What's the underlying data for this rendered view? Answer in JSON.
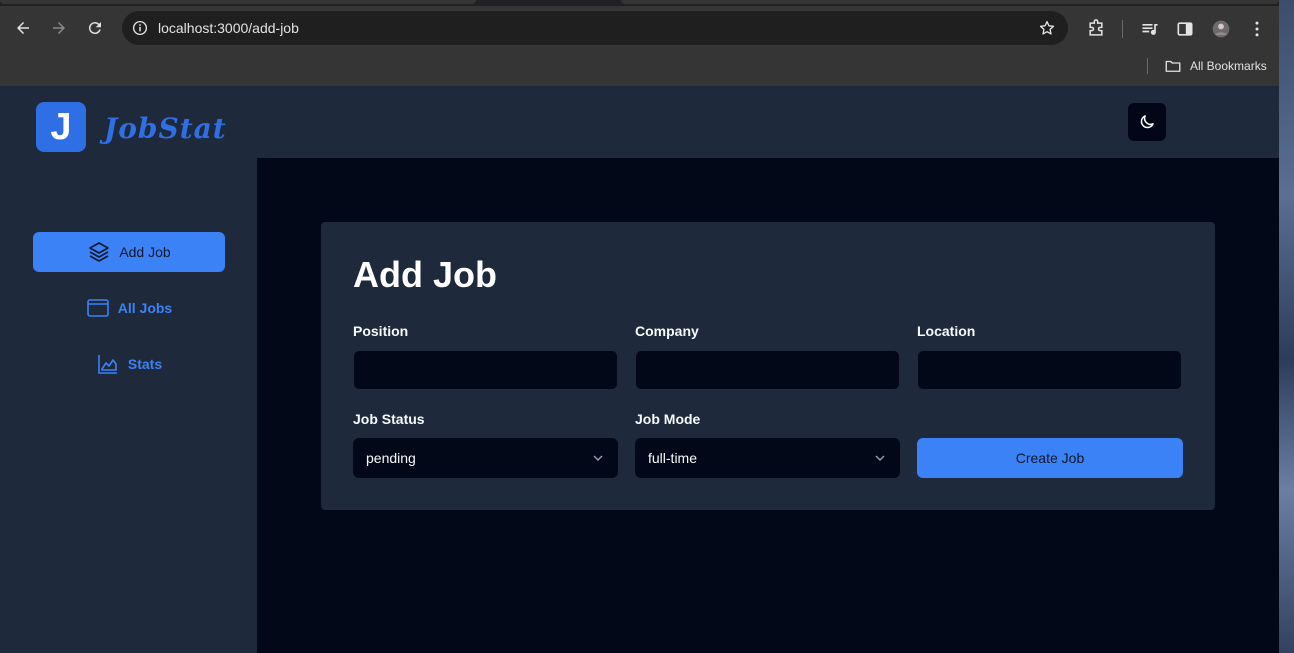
{
  "browser": {
    "url": "localhost:3000/add-job",
    "bookmarks_label": "All Bookmarks"
  },
  "app": {
    "logo_letter": "J",
    "logo_text": "JobStat",
    "accent_color": "#3b82f6"
  },
  "sidebar": {
    "items": [
      {
        "label": "Add Job",
        "icon": "layers-icon",
        "active": true
      },
      {
        "label": "All Jobs",
        "icon": "app-window-icon",
        "active": false
      },
      {
        "label": "Stats",
        "icon": "area-chart-icon",
        "active": false
      }
    ]
  },
  "form": {
    "title": "Add Job",
    "position_label": "Position",
    "position_value": "",
    "company_label": "Company",
    "company_value": "",
    "location_label": "Location",
    "location_value": "",
    "status_label": "Job Status",
    "status_value": "pending",
    "mode_label": "Job Mode",
    "mode_value": "full-time",
    "submit_label": "Create Job"
  }
}
